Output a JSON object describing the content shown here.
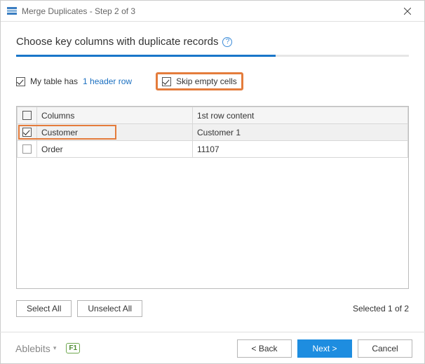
{
  "window": {
    "title": "Merge Duplicates - Step 2 of 3"
  },
  "heading": "Choose key columns with duplicate records",
  "progress": {
    "percent": 66
  },
  "options": {
    "table_has_prefix": "My table has",
    "header_row_link": "1 header row",
    "table_has_checked": true,
    "skip_empty_label": "Skip empty cells",
    "skip_empty_checked": true
  },
  "table": {
    "header_columns": "Columns",
    "header_firstrow": "1st row content",
    "rows": [
      {
        "checked": true,
        "name": "Customer",
        "first": "Customer 1",
        "highlighted": true
      },
      {
        "checked": false,
        "name": "Order",
        "first": "11107",
        "highlighted": false
      }
    ]
  },
  "actions": {
    "select_all": "Select All",
    "unselect_all": "Unselect All",
    "selected_status": "Selected 1 of 2"
  },
  "footer": {
    "brand": "Ablebits",
    "help_badge": "F1",
    "back": "<  Back",
    "next": "Next  >",
    "cancel": "Cancel"
  }
}
